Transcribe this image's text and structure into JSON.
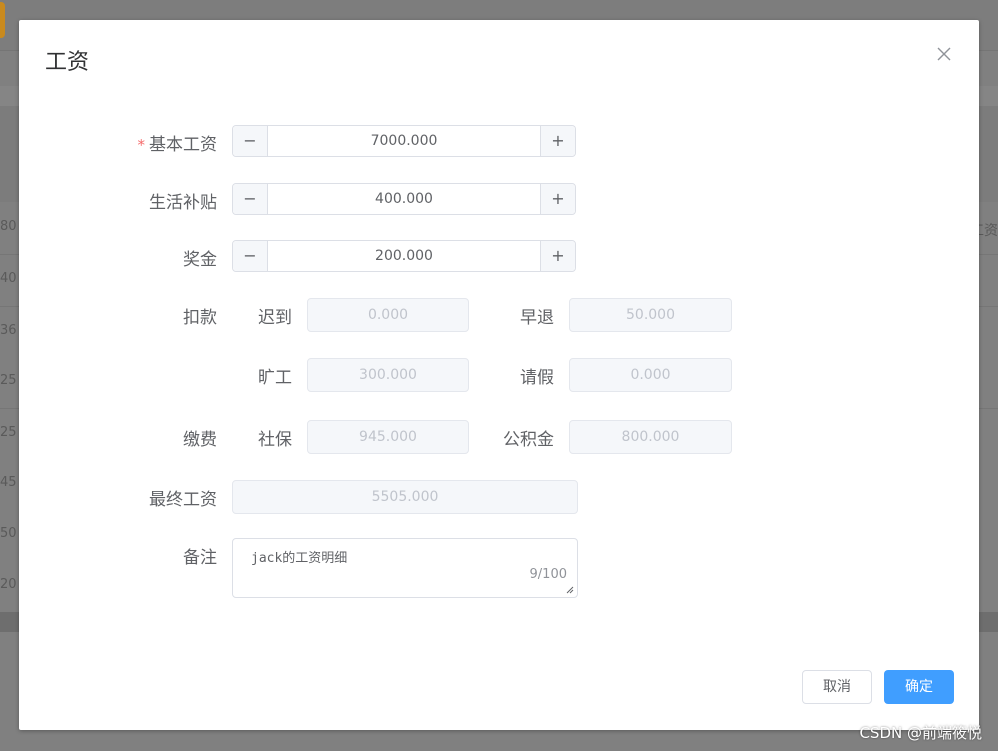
{
  "background": {
    "row_values": [
      "80",
      "40",
      "36",
      "25",
      "25",
      "45",
      "50",
      "20"
    ],
    "right_text": "工资"
  },
  "dialog": {
    "title": "工资",
    "close_icon": "close-icon",
    "fields": {
      "base_salary": {
        "label": "基本工资",
        "required_mark": "*",
        "value": "7000.000",
        "minus": "−",
        "plus": "+"
      },
      "living_allowance": {
        "label": "生活补贴",
        "value": "400.000",
        "minus": "−",
        "plus": "+"
      },
      "bonus": {
        "label": "奖金",
        "value": "200.000",
        "minus": "−",
        "plus": "+"
      },
      "deduction": {
        "label": "扣款",
        "late": {
          "label": "迟到",
          "value": "0.000"
        },
        "early_leave": {
          "label": "早退",
          "value": "50.000"
        },
        "absence": {
          "label": "旷工",
          "value": "300.000"
        },
        "leave": {
          "label": "请假",
          "value": "0.000"
        }
      },
      "payment": {
        "label": "缴费",
        "social_insurance": {
          "label": "社保",
          "value": "945.000"
        },
        "housing_fund": {
          "label": "公积金",
          "value": "800.000"
        }
      },
      "final_salary": {
        "label": "最终工资",
        "value": "5505.000"
      },
      "remark": {
        "label": "备注",
        "value": "jack的工资明细",
        "count": "9/100"
      }
    },
    "buttons": {
      "cancel": "取消",
      "confirm": "确定"
    }
  },
  "watermark": "CSDN @前端筱悦",
  "colors": {
    "primary": "#409eff",
    "required": "#f56c6c"
  }
}
